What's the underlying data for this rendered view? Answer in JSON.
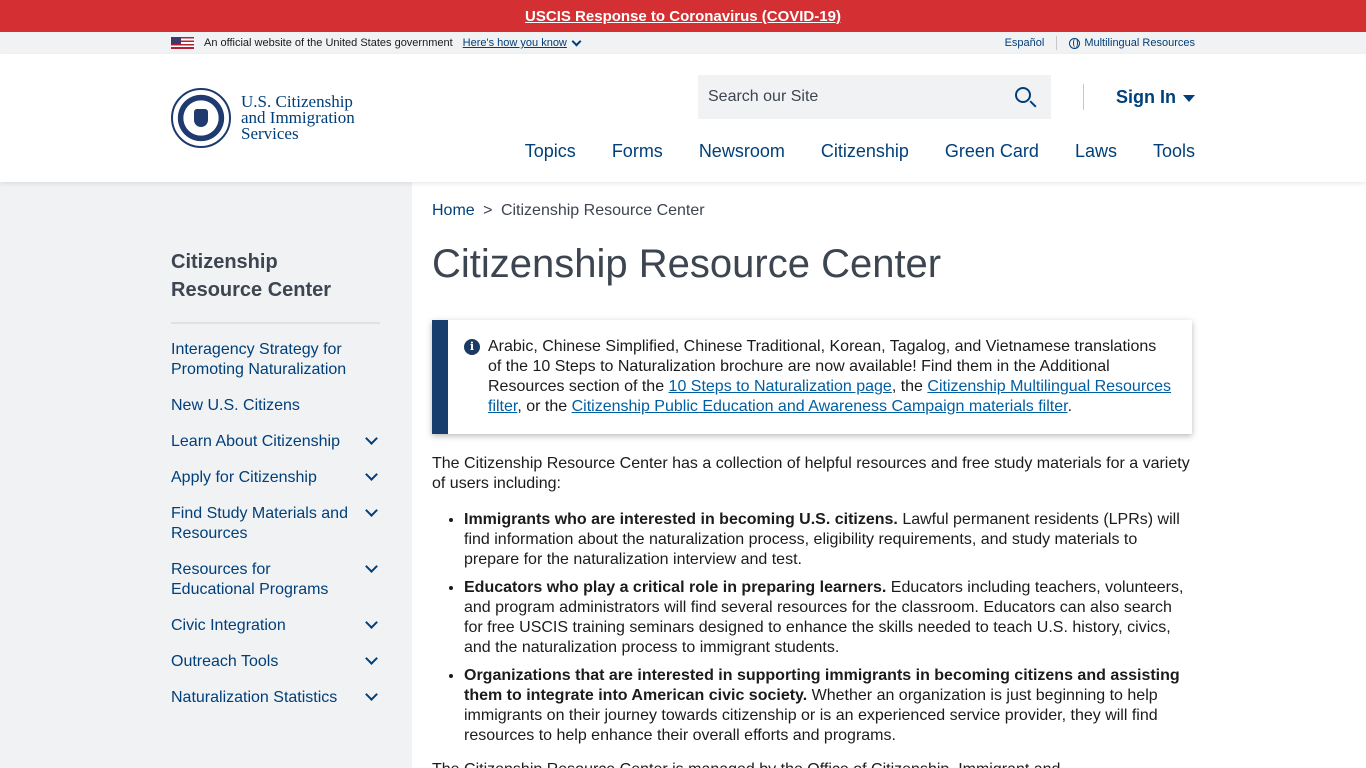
{
  "alert": {
    "text": "USCIS Response to Coronavirus (COVID-19)"
  },
  "gov_banner": {
    "official_text": "An official website of the United States government",
    "howto": "Here's how you know",
    "espanol": "Español",
    "multilingual": "Multilingual Resources"
  },
  "header": {
    "logo_line1": "U.S. Citizenship",
    "logo_line2": "and Immigration",
    "logo_line3": "Services",
    "search_placeholder": "Search our Site",
    "sign_in": "Sign In",
    "nav": [
      "Topics",
      "Forms",
      "Newsroom",
      "Citizenship",
      "Green Card",
      "Laws",
      "Tools"
    ]
  },
  "sidebar": {
    "title": "Citizenship Resource Center",
    "items": [
      {
        "label": "Interagency Strategy for Promoting Naturalization"
      },
      {
        "label": "New U.S. Citizens"
      },
      {
        "label": "Learn About Citizenship"
      },
      {
        "label": "Apply for Citizenship"
      },
      {
        "label": "Find Study Materials and Resources"
      },
      {
        "label": "Resources for Educational Programs"
      },
      {
        "label": "Civic Integration"
      },
      {
        "label": "Outreach Tools"
      },
      {
        "label": "Naturalization Statistics"
      }
    ]
  },
  "breadcrumb": {
    "home": "Home",
    "sep": ">",
    "current": "Citizenship Resource Center"
  },
  "page_title": "Citizenship Resource Center",
  "notice": {
    "text1": "Arabic, Chinese Simplified, Chinese Traditional, Korean, Tagalog, and Vietnamese translations of the 10 Steps to Naturalization brochure are now available! Find them in the Additional Resources section of the ",
    "link1": "10 Steps to Naturalization page",
    "text2": ", the ",
    "link2": "Citizenship Multilingual Resources filter",
    "text3": ", or the ",
    "link3": "Citizenship Public Education and Awareness Campaign materials filter",
    "text4": "."
  },
  "intro": "The Citizenship Resource Center has a collection of helpful resources and free study materials for a variety of users including:",
  "groups": [
    {
      "bold": "Immigrants who are interested in becoming U.S. citizens.",
      "text": " Lawful permanent residents (LPRs) will find information about the naturalization process, eligibility requirements, and study materials to prepare for the naturalization interview and test."
    },
    {
      "bold": "Educators who play a critical role in preparing learners.",
      "text": " Educators including teachers, volunteers, and program administrators will find several resources for the classroom. Educators can also search for free USCIS training seminars designed to enhance the skills needed to teach U.S. history, civics, and the naturalization process to immigrant students."
    },
    {
      "bold": "Organizations that are interested in supporting immigrants in becoming citizens and assisting them to integrate into American civic society.",
      "text": " Whether an organization is just beginning to help immigrants on their journey towards citizenship or is an experienced service provider, they will find resources to help enhance their overall efforts and programs."
    }
  ],
  "tail": "The Citizenship Resource Center is managed by the Office of Citizenship, Immigrant and..."
}
